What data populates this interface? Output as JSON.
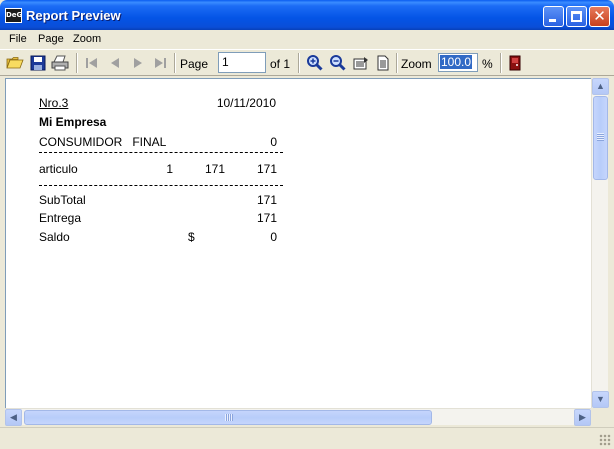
{
  "window": {
    "title": "Report Preview",
    "app_icon_text": "DeG",
    "controls": {
      "minimize": "minimize-icon",
      "maximize": "maximize-icon",
      "close": "close-icon"
    }
  },
  "menu": {
    "items": [
      "File",
      "Page",
      "Zoom"
    ]
  },
  "toolbar": {
    "page_label": "Page",
    "page_value": "1",
    "of_label": "of 1",
    "zoom_label": "Zoom",
    "zoom_value": "100.0",
    "percent_label": "%",
    "icons": [
      "open-folder-icon",
      "save-icon",
      "print-icon",
      "first-page-icon",
      "previous-page-icon",
      "next-page-icon",
      "last-page-icon",
      "zoom-in-icon",
      "zoom-out-icon",
      "page-width-icon",
      "whole-page-icon",
      "exit-icon"
    ]
  },
  "report": {
    "number": "Nro.3",
    "date": "10/11/2010",
    "company": "Mi Empresa",
    "customer": "CONSUMIDOR   FINAL",
    "customer_value": "0",
    "line": {
      "item": "articulo",
      "qty": "1",
      "price": "171",
      "total": "171"
    },
    "subtotal_label": "SubTotal",
    "subtotal_value": "171",
    "entrega_label": "Entrega",
    "entrega_value": "171",
    "saldo_label": "Saldo",
    "saldo_currency": "$",
    "saldo_value": "0"
  },
  "colors": {
    "titlebar": "#0454e6",
    "selection": "#316ac5",
    "chrome": "#ece9d8"
  }
}
